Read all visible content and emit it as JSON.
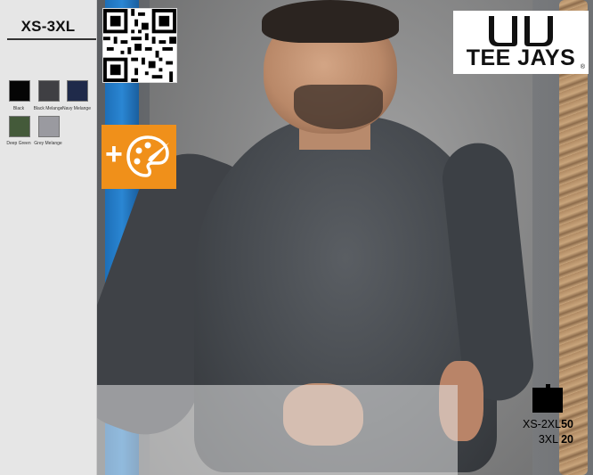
{
  "sidebar": {
    "size_range": "XS-3XL",
    "colors": [
      {
        "name": "Black",
        "hex": "#050505"
      },
      {
        "name": "Black Melange",
        "hex": "#3f3f43"
      },
      {
        "name": "Navy Melange",
        "hex": "#1f2a4a"
      },
      {
        "name": "Deep Green",
        "hex": "#445a3a"
      },
      {
        "name": "Grey Melange",
        "hex": "#9a9aa0"
      }
    ]
  },
  "logo": {
    "text": "TEE JAYS",
    "reg": "®"
  },
  "badges": {
    "qr_icon": "qr-code-icon",
    "palette_icon": "palette-brush-icon",
    "palette_color": "#f0901a"
  },
  "packaging": {
    "box_icon": "carton-box-icon",
    "rows": [
      {
        "sizes": "XS-2XL",
        "qty": "50"
      },
      {
        "sizes": "3XL",
        "qty": "20"
      }
    ]
  }
}
